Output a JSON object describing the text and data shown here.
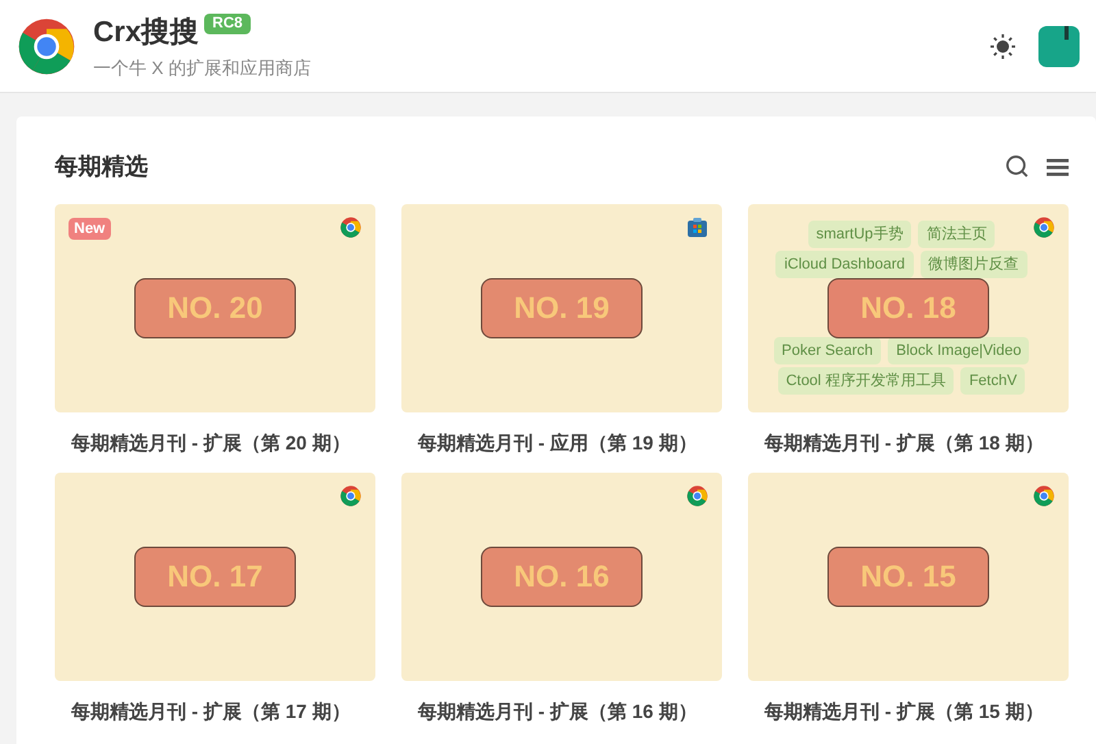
{
  "header": {
    "brand": "Crx搜搜",
    "badge": "RC8",
    "subtitle": "一个牛 X 的扩展和应用商店"
  },
  "section": {
    "title": "每期精选"
  },
  "issues": [
    {
      "label": "NO. 20",
      "title": "每期精选月刊 - 扩展（第 20 期）",
      "kind": "chrome",
      "badge": "New"
    },
    {
      "label": "NO. 19",
      "title": "每期精选月刊 - 应用（第 19 期）",
      "kind": "store"
    },
    {
      "label": "NO. 18",
      "title": "每期精选月刊 - 扩展（第 18 期）",
      "kind": "chrome",
      "tags": [
        [
          "smartUp手势",
          "简法主页"
        ],
        [
          "iCloud Dashboard",
          "微博图片反查"
        ],
        [
          "Poker Search",
          "Block Image|Video"
        ],
        [
          "Ctool 程序开发常用工具",
          "FetchV"
        ]
      ]
    },
    {
      "label": "NO. 17",
      "title": "每期精选月刊 - 扩展（第 17 期）",
      "kind": "chrome"
    },
    {
      "label": "NO. 16",
      "title": "每期精选月刊 - 扩展（第 16 期）",
      "kind": "chrome"
    },
    {
      "label": "NO. 15",
      "title": "每期精选月刊 - 扩展（第 15 期）",
      "kind": "chrome"
    }
  ]
}
